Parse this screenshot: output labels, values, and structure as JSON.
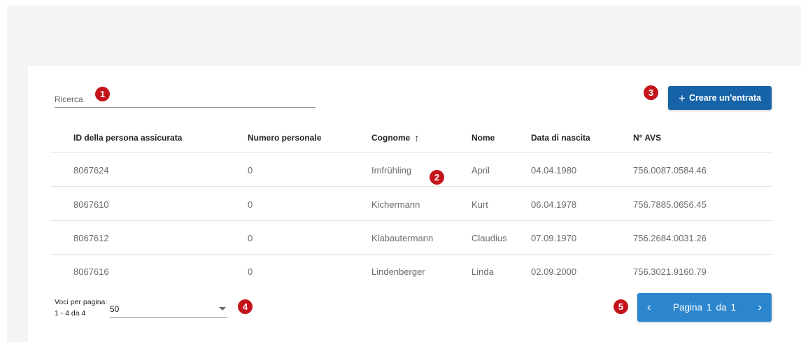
{
  "search": {
    "placeholder": "Ricerca"
  },
  "toolbar": {
    "create_plus": "+",
    "create_label": "Creare un'entrata"
  },
  "markers": [
    "1",
    "2",
    "3",
    "4",
    "5"
  ],
  "table": {
    "headers": [
      "ID della persona assicurata",
      "Numero personale",
      "Cognome",
      "Nome",
      "Data di nascita",
      "N° AVS"
    ],
    "sort_arrow": "↑",
    "rows": [
      [
        "8067624",
        "0",
        "Imfrühling",
        "April",
        "04.04.1980",
        "756.0087.0584.46"
      ],
      [
        "8067610",
        "0",
        "Kichermann",
        "Kurt",
        "06.04.1978",
        "756.7885.0656.45"
      ],
      [
        "8067612",
        "0",
        "Klabautermann",
        "Claudius",
        "07.09.1970",
        "756.2684.0031.26"
      ],
      [
        "8067616",
        "0",
        "Lindenberger",
        "Linda",
        "02.09.2000",
        "756.3021.9160.79"
      ]
    ]
  },
  "footer": {
    "per_page_label": "Voci per pagina:",
    "range": "1 - 4 da 4",
    "per_page_value": "50",
    "pager_prev": "‹",
    "pager_next": "›",
    "pager_word": "Pagina",
    "pager_current": "1",
    "pager_of": "da",
    "pager_total": "1"
  },
  "colors": {
    "accent_button": "#1663a8",
    "pager": "#2b86cd",
    "marker": "#c4141a"
  }
}
